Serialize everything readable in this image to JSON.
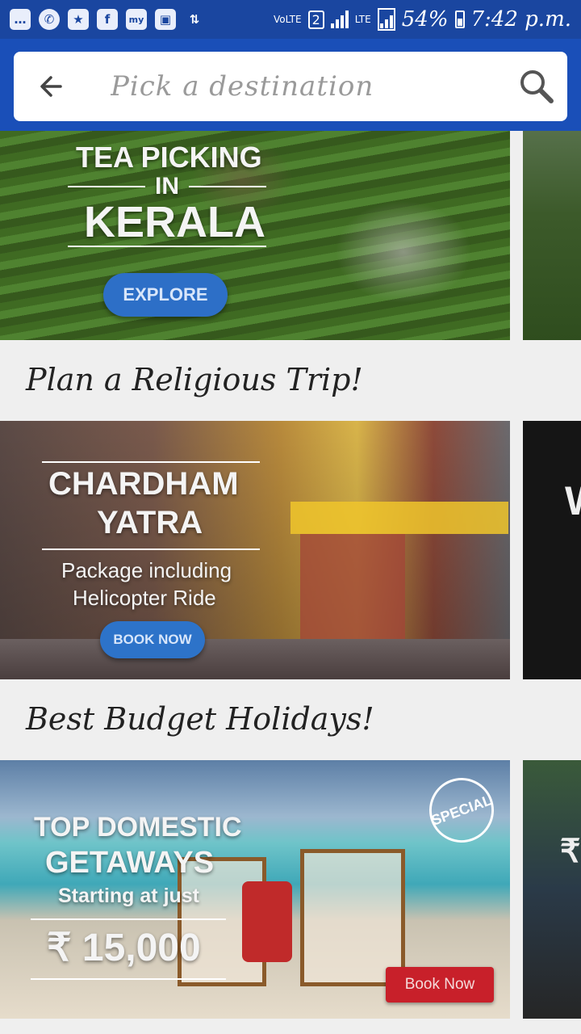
{
  "status_bar": {
    "network": "VoLTE",
    "sim": "2",
    "lte": "LTE",
    "battery": "54%",
    "time": "7:42 p.m."
  },
  "search": {
    "placeholder": "Pick a destination"
  },
  "banners": {
    "kerala": {
      "line1": "TEA PICKING",
      "line2": "IN",
      "line3": "KERALA",
      "button": "EXPLORE"
    },
    "chardham": {
      "line1": "CHARDHAM",
      "line2": "YATRA",
      "line3": "Package including",
      "line4": "Helicopter Ride",
      "button": "BOOK NOW"
    },
    "budget": {
      "line1": "TOP DOMESTIC",
      "line2": "GETAWAYS",
      "line3": "Starting at just",
      "price": "₹ 15,000",
      "seal": "SPECIAL",
      "button": "Book Now"
    }
  },
  "sections": {
    "religious": "Plan a Religious Trip!",
    "budget": "Best Budget Holidays!"
  },
  "colors": {
    "status_bar": "#1a46a0",
    "app_bar": "#1a4fb8",
    "background": "#efefef",
    "book_now_red": "#c8202a"
  }
}
